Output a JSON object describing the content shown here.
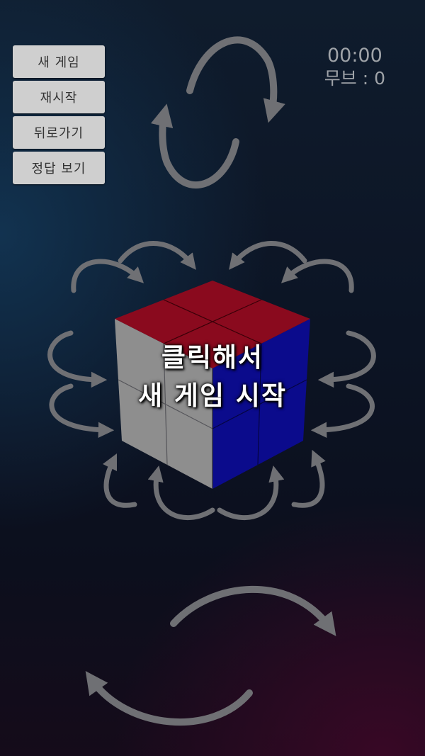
{
  "menu": {
    "new_game": "새 게임",
    "restart": "재시작",
    "undo": "뒤로가기",
    "show_answer": "정답 보기"
  },
  "stats": {
    "timer": "00:00",
    "moves": "무브 : 0"
  },
  "overlay": {
    "line1": "클릭해서",
    "line2": "새 게임 시작"
  },
  "colors": {
    "cube_top": "#8a0a1e",
    "cube_right": "#0b0b8c",
    "cube_left": "#8e8e8e",
    "arrow": "#6f7074"
  }
}
